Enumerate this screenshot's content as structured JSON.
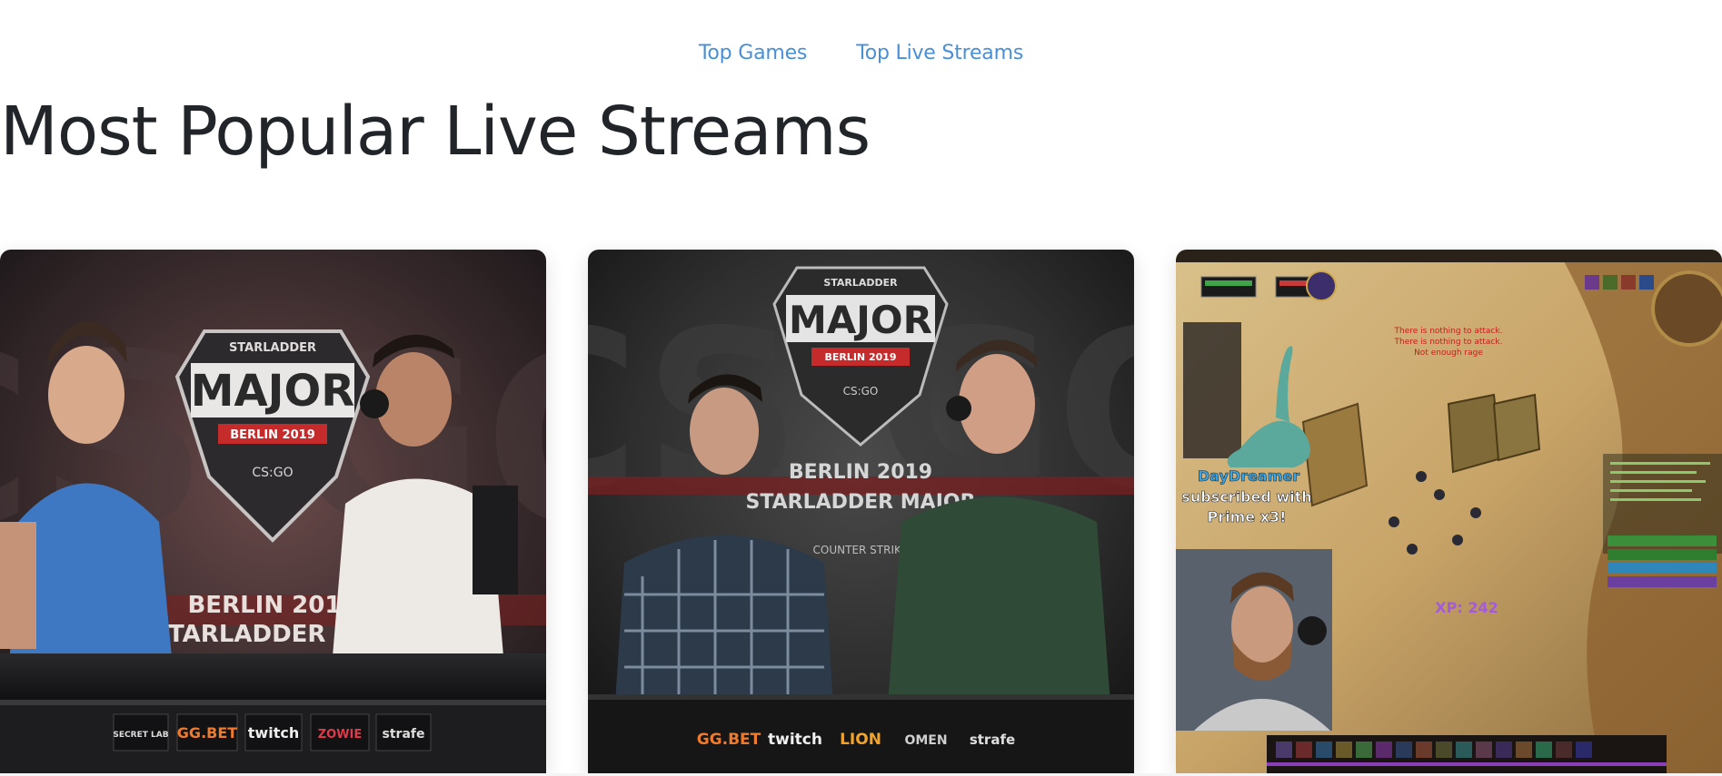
{
  "nav": {
    "items": [
      {
        "label": "Top Games"
      },
      {
        "label": "Top Live Streams"
      }
    ]
  },
  "page_title": "Most Popular Live Streams",
  "streams": [
    {
      "thumbnail": {
        "backdrop_text": "CS GO",
        "logo_top": "STARLADDER",
        "logo_main": "MAJOR",
        "logo_sub": "BERLIN 2019",
        "logo_mark": "CS:GO",
        "wall_text_1": "BERLIN 2019",
        "wall_text_2": "STARLADDER MA..",
        "sponsors": [
          "SECRET LAB",
          "GG.BET",
          "twitch",
          "ZOWIE",
          "strafe"
        ]
      }
    },
    {
      "thumbnail": {
        "backdrop_text": "CS GO",
        "logo_top": "STARLADDER",
        "logo_main": "MAJOR",
        "logo_sub": "BERLIN 2019",
        "logo_mark": "CS:GO",
        "wall_text_1": "BERLIN 2019",
        "wall_text_2": "STARLADDER MAJOR",
        "wall_text_3": "COUNTER STRIKE",
        "sponsors": [
          "GG.BET",
          "twitch",
          "LION",
          "OMEN",
          "strafe"
        ]
      }
    },
    {
      "thumbnail": {
        "alert_name": "DayDreamer",
        "alert_text_1": "subscribed with",
        "alert_text_2": "Prime x3!",
        "xp_text": "XP: 242",
        "combat_text_1": "There is nothing to attack.",
        "combat_text_2": "There is nothing to attack.",
        "combat_text_3": "Not enough rage"
      }
    }
  ],
  "colors": {
    "link": "#4a8fd6",
    "title": "#212529",
    "major_red": "#c62b2b",
    "alert_blue": "#3aa6e8",
    "xp_purple": "#a35cd6"
  }
}
